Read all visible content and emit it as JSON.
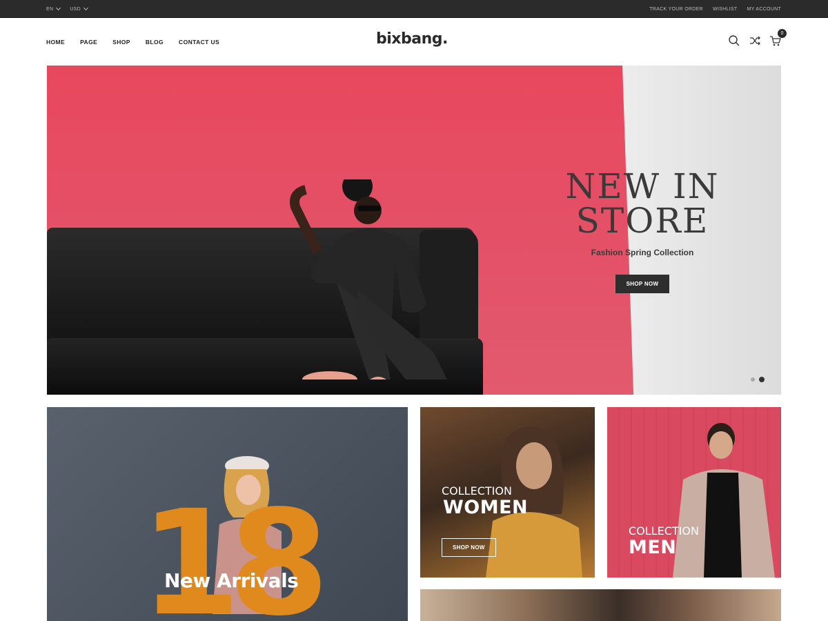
{
  "topbar": {
    "language": "EN",
    "currency": "USD",
    "links": [
      "TRACK YOUR ORDER",
      "WISHLIST",
      "MY ACCOUNT"
    ]
  },
  "header": {
    "nav": [
      "HOME",
      "PAGE",
      "SHOP",
      "BLOG",
      "CONTACT US"
    ],
    "logo": "bixbang.",
    "icons": [
      "search-icon",
      "shuffle-icon",
      "cart-icon"
    ],
    "cart_count": "0"
  },
  "hero": {
    "title_line1": "NEW IN",
    "title_line2": "STORE",
    "subtitle": "Fashion Spring Collection",
    "button": "SHOP NOW",
    "slides": 2,
    "active_slide": 2
  },
  "banners": {
    "arrivals": {
      "number": "18",
      "label": "New Arrivals"
    },
    "women": {
      "small": "COLLECTION",
      "big": "WOMEN",
      "button": "SHOP NOW"
    },
    "men": {
      "small": "COLLECTION",
      "big": "MEN"
    }
  },
  "colors": {
    "topbar_bg": "#2b2b2b",
    "hero_red": "#e8485e",
    "accent_orange": "#e08a1e",
    "button_dark": "#2e2e2e"
  }
}
